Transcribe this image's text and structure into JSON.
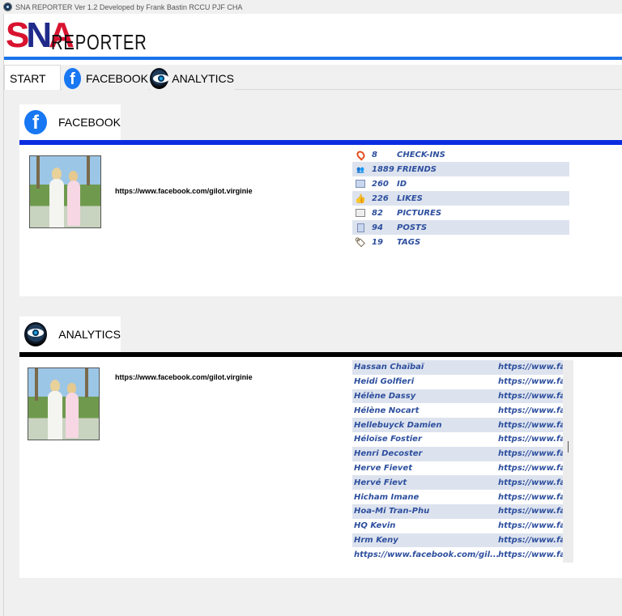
{
  "titlebar": {
    "title": "SNA REPORTER Ver 1.2 Developed by Frank Bastin RCCU PJF CHA"
  },
  "logo": {
    "s": "S",
    "n": "N",
    "a": "A",
    "rest": "REPORTER"
  },
  "tabs": [
    {
      "label": "START",
      "active": true
    },
    {
      "label": "FACEBOOK",
      "icon": "facebook-icon"
    },
    {
      "label": "ANALYTICS",
      "icon": "eye-icon"
    }
  ],
  "facebook_section": {
    "title": "FACEBOOK",
    "icon": "facebook-icon",
    "rule_color": "#0a2de0",
    "profile_url": "https://www.facebook.com/gilot.virginie",
    "stats": [
      {
        "icon": "pin-icon",
        "value": "8",
        "label": "CHECK-INS"
      },
      {
        "icon": "friends-icon",
        "value": "1889",
        "label": "FRIENDS"
      },
      {
        "icon": "id-icon",
        "value": "260",
        "label": "ID"
      },
      {
        "icon": "like-icon",
        "value": "226",
        "label": "LIKES"
      },
      {
        "icon": "picture-icon",
        "value": "82",
        "label": "PICTURES"
      },
      {
        "icon": "post-icon",
        "value": "94",
        "label": "POSTS"
      },
      {
        "icon": "tag-icon",
        "value": "19",
        "label": "TAGS"
      }
    ]
  },
  "analytics_section": {
    "title": "ANALYTICS",
    "icon": "eye-icon",
    "rule_color": "#000000",
    "profile_url": "https://www.facebook.com/gilot.virginie",
    "friends": [
      {
        "name": "Hassan Chaïbaï",
        "link": "https://www.fa"
      },
      {
        "name": "Heidi Golfieri",
        "link": "https://www.fa"
      },
      {
        "name": "Hélène Dassy",
        "link": "https://www.fa"
      },
      {
        "name": "Hélène Nocart",
        "link": "https://www.fa"
      },
      {
        "name": "Hellebuyck Damien",
        "link": "https://www.fa"
      },
      {
        "name": "Héloïse Fostier",
        "link": "https://www.fa"
      },
      {
        "name": "Henri Decoster",
        "link": "https://www.fa"
      },
      {
        "name": "Herve Fievet",
        "link": "https://www.fa"
      },
      {
        "name": "Hervé Fievt",
        "link": "https://www.fa"
      },
      {
        "name": "Hicham Imane",
        "link": "https://www.fa"
      },
      {
        "name": "Hoa-Mi Tran-Phu",
        "link": "https://www.fa"
      },
      {
        "name": "HQ Kevin",
        "link": "https://www.fa"
      },
      {
        "name": "Hrm Keny",
        "link": "https://www.fa"
      },
      {
        "name": "https://www.facebook.com/gil...",
        "link": "https://www.fa"
      }
    ]
  },
  "colors": {
    "accent_blue": "#1a73e8",
    "table_text": "#2d4f9e",
    "table_alt_row": "#dde3ee"
  }
}
